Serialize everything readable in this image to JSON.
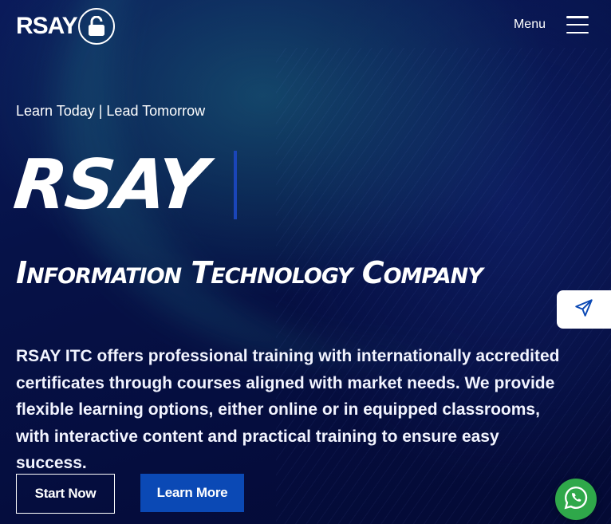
{
  "header": {
    "logo_text": "RSAY",
    "logo_icon": "lock-icon",
    "menu_label": "Menu",
    "menu_icon": "hamburger-icon"
  },
  "hero": {
    "tagline": "Learn Today | Lead Tomorrow",
    "brand_title": "RSAY",
    "subtitle": "Information Technology Company",
    "description": "RSAY ITC offers professional training with internationally accredited certificates through courses aligned with market needs. We provide flexible learning options, either online or in equipped classrooms, with interactive content and practical training to ensure easy success.",
    "buttons": {
      "start": "Start Now",
      "learn": "Learn More"
    }
  },
  "floating": {
    "send_icon": "send-icon",
    "whatsapp_icon": "whatsapp-icon"
  },
  "colors": {
    "background": "#061248",
    "accent_blue": "#0b49b5",
    "whatsapp_green": "#2fa84a"
  }
}
